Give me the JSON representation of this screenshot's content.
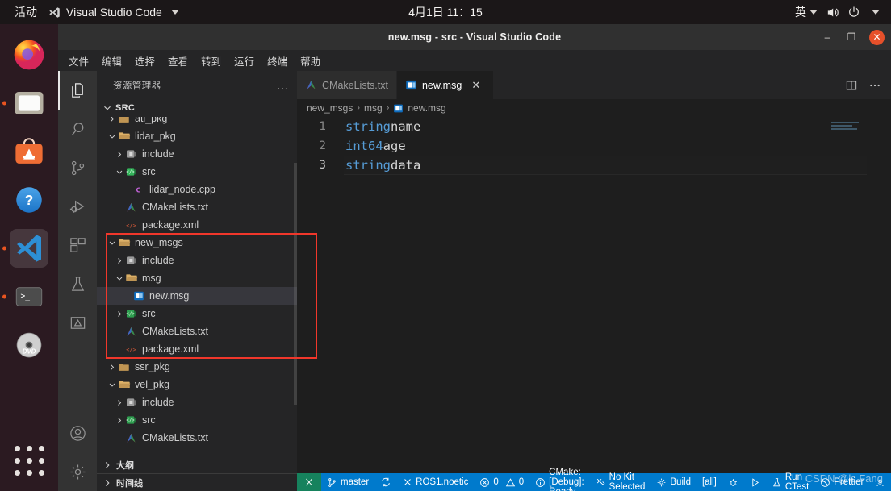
{
  "desktop": {
    "activities": "活动",
    "app_menu": "Visual Studio Code",
    "clock": "4月1日  11：15",
    "input_method": "英",
    "dock": [
      {
        "name": "firefox",
        "running": false,
        "active": false
      },
      {
        "name": "files",
        "running": true,
        "active": false
      },
      {
        "name": "ubuntu-software",
        "running": false,
        "active": false
      },
      {
        "name": "help",
        "running": false,
        "active": false
      },
      {
        "name": "visual-studio-code",
        "running": true,
        "active": true
      },
      {
        "name": "terminal",
        "running": true,
        "active": false
      },
      {
        "name": "rhythmbox-dvd",
        "running": false,
        "active": false
      }
    ],
    "show_apps_label": "显示应用程序"
  },
  "window": {
    "title": "new.msg - src - Visual Studio Code",
    "minimize": "‒",
    "maximize": "❐",
    "close": "✕"
  },
  "menubar": {
    "items": [
      "文件",
      "编辑",
      "选择",
      "查看",
      "转到",
      "运行",
      "终端",
      "帮助"
    ]
  },
  "activitybar": {
    "items": [
      {
        "name": "explorer",
        "icon": "files-icon",
        "active": true
      },
      {
        "name": "search",
        "icon": "search-icon",
        "active": false
      },
      {
        "name": "source-control",
        "icon": "source-control-icon",
        "active": false
      },
      {
        "name": "run-and-debug",
        "icon": "run-debug-icon",
        "active": false
      },
      {
        "name": "extensions",
        "icon": "extensions-icon",
        "active": false
      },
      {
        "name": "testing",
        "icon": "flask-icon",
        "active": false
      },
      {
        "name": "cmake",
        "icon": "cmake-icon",
        "active": false
      }
    ],
    "bottom": [
      {
        "name": "accounts",
        "icon": "account-icon"
      },
      {
        "name": "manage",
        "icon": "gear-icon"
      }
    ]
  },
  "sidebar": {
    "title": "资源管理器",
    "more_actions": "...",
    "root": {
      "label": "SRC",
      "expanded": true
    },
    "tree": [
      {
        "label": "atl_pkg",
        "indent": 1,
        "twisty": "collapsed",
        "icon": "folder",
        "clipped": true
      },
      {
        "label": "lidar_pkg",
        "indent": 1,
        "twisty": "expanded",
        "icon": "folder-open"
      },
      {
        "label": "include",
        "indent": 2,
        "twisty": "collapsed",
        "icon": "folder-include"
      },
      {
        "label": "src",
        "indent": 2,
        "twisty": "expanded",
        "icon": "folder-src-open"
      },
      {
        "label": "lidar_node.cpp",
        "indent": 3,
        "twisty": "none",
        "icon": "cpp"
      },
      {
        "label": "CMakeLists.txt",
        "indent": 2,
        "twisty": "none",
        "icon": "cmake"
      },
      {
        "label": "package.xml",
        "indent": 2,
        "twisty": "none",
        "icon": "xml"
      },
      {
        "label": "new_msgs",
        "indent": 1,
        "twisty": "expanded",
        "icon": "folder-open"
      },
      {
        "label": "include",
        "indent": 2,
        "twisty": "collapsed",
        "icon": "folder-include"
      },
      {
        "label": "msg",
        "indent": 2,
        "twisty": "expanded",
        "icon": "folder-open"
      },
      {
        "label": "new.msg",
        "indent": 3,
        "twisty": "none",
        "icon": "msg",
        "selected": true
      },
      {
        "label": "src",
        "indent": 2,
        "twisty": "collapsed",
        "icon": "folder-src"
      },
      {
        "label": "CMakeLists.txt",
        "indent": 2,
        "twisty": "none",
        "icon": "cmake"
      },
      {
        "label": "package.xml",
        "indent": 2,
        "twisty": "none",
        "icon": "xml"
      },
      {
        "label": "ssr_pkg",
        "indent": 1,
        "twisty": "collapsed",
        "icon": "folder"
      },
      {
        "label": "vel_pkg",
        "indent": 1,
        "twisty": "expanded",
        "icon": "folder-open"
      },
      {
        "label": "include",
        "indent": 2,
        "twisty": "collapsed",
        "icon": "folder-include"
      },
      {
        "label": "src",
        "indent": 2,
        "twisty": "collapsed",
        "icon": "folder-src"
      },
      {
        "label": "CMakeLists.txt",
        "indent": 2,
        "twisty": "none",
        "icon": "cmake",
        "clipped": true
      }
    ],
    "panels": [
      {
        "label": "大纲"
      },
      {
        "label": "时间线"
      }
    ]
  },
  "editor": {
    "tabs": [
      {
        "label": "CMakeLists.txt",
        "icon": "cmake",
        "active": false,
        "closable": false
      },
      {
        "label": "new.msg",
        "icon": "msg",
        "active": true,
        "closable": true,
        "close": "✕"
      }
    ],
    "actions": [
      {
        "name": "split-editor-right",
        "icon": "split-icon"
      },
      {
        "name": "more-actions",
        "icon": "ellipsis-icon"
      }
    ],
    "breadcrumb": [
      "new_msgs",
      "msg",
      "new.msg"
    ],
    "breadcrumb_separator": "›",
    "lines": [
      {
        "number": "1",
        "keyword": "string",
        "identifier": "name",
        "current": false
      },
      {
        "number": "2",
        "keyword": "int64",
        "identifier": "age",
        "current": false
      },
      {
        "number": "3",
        "keyword": "string",
        "identifier": "data",
        "current": true
      }
    ]
  },
  "statusbar": {
    "remote": "remote-indicator",
    "items": [
      {
        "name": "branch",
        "icon": "git-branch-icon",
        "label": "master"
      },
      {
        "name": "sync",
        "icon": "sync-icon",
        "label": ""
      },
      {
        "name": "ros-version",
        "icon": "x-icon",
        "label": "ROS1.noetic"
      },
      {
        "name": "problems",
        "icon": "error-warning-icon",
        "label": "0  0"
      },
      {
        "name": "cmake-status",
        "icon": "info-icon",
        "label": "CMake: [Debug]: Ready"
      },
      {
        "name": "cmake-kit",
        "icon": "tools-icon",
        "label": "No Kit Selected"
      },
      {
        "name": "cmake-build",
        "icon": "gear-icon",
        "label": "Build"
      },
      {
        "name": "cmake-target",
        "icon": "none",
        "label": "[all]"
      },
      {
        "name": "cmake-debug",
        "icon": "bug-icon",
        "label": ""
      },
      {
        "name": "cmake-launch",
        "icon": "play-icon",
        "label": ""
      },
      {
        "name": "run-ctest",
        "icon": "beaker-icon",
        "label": "Run CTest"
      }
    ],
    "right": [
      {
        "name": "prettier",
        "icon": "prohibited-icon",
        "label": "Prettier"
      },
      {
        "name": "feedback",
        "icon": "smiley-icon",
        "label": ""
      },
      {
        "name": "notifications",
        "icon": "bell-icon",
        "label": ""
      }
    ]
  },
  "watermark": "CSDN @ls Fang",
  "colors": {
    "accent": "#007acc",
    "annotation": "#f1372b",
    "remote_green": "#16825d",
    "ubuntu_orange": "#e95420"
  }
}
